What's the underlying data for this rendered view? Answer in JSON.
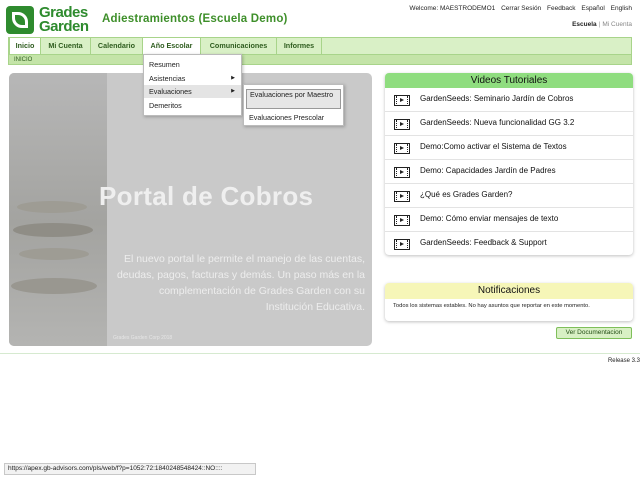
{
  "header": {
    "logo_line1": "Grades",
    "logo_line2": "Garden",
    "org_title": "Adiestramientos (Escuela Demo)",
    "welcome": "Welcome: MAESTRODEMO1",
    "logout": "Cerrar Sesión",
    "feedback": "Feedback",
    "lang_es": "Español",
    "lang_en": "English",
    "scope_active": "Escuela",
    "scope_sep": "|",
    "scope_other": "Mi Cuenta"
  },
  "nav": {
    "tabs": [
      "Inicio",
      "Mi Cuenta",
      "Calendario",
      "Año Escolar",
      "Comunicaciones",
      "Informes"
    ],
    "breadcrumb": "INICIO"
  },
  "menu": {
    "items": [
      "Resumen",
      "Asistencias",
      "Evaluaciones",
      "Demeritos"
    ],
    "arrow": "▶",
    "submenu": [
      "Evaluaciones por Maestro",
      "Evaluaciones Prescolar"
    ]
  },
  "banner": {
    "title": "Portal de Cobros",
    "text": "El nuevo portal le permite el manejo de las cuentas, deudas, pagos, facturas y demás. Un paso más en la complementación de Grades Garden con su Institución Educativa.",
    "credit": "Grades Garden Corp 2018"
  },
  "videos": {
    "title": "Videos Tutoriales",
    "icon": "video-film-icon",
    "items": [
      "GardenSeeds: Seminario Jardín de Cobros",
      "GardenSeeds: Nueva funcionalidad GG 3.2",
      "Demo:Como activar el Sistema de Textos",
      "Demo: Capacidades Jardín de Padres",
      "¿Qué es Grades Garden?",
      "Demo: Cómo enviar mensajes de texto",
      "GardenSeeds: Feedback & Support"
    ]
  },
  "notifications": {
    "title": "Notificaciones",
    "text": "Todos los sistemas estables. No hay asuntos que reportar en este momento."
  },
  "doc_button": "Ver Documentacion",
  "release": "Release 3.3",
  "status_url": "https://apex.gb-advisors.com/pls/web/f?p=1052:72:1840248548424::NO::::",
  "colors": {
    "brand_green": "#2e8b2e",
    "nav_bg": "#d9f0c6",
    "video_header": "#8fdd7f",
    "notif_header": "#f6f6b8"
  }
}
